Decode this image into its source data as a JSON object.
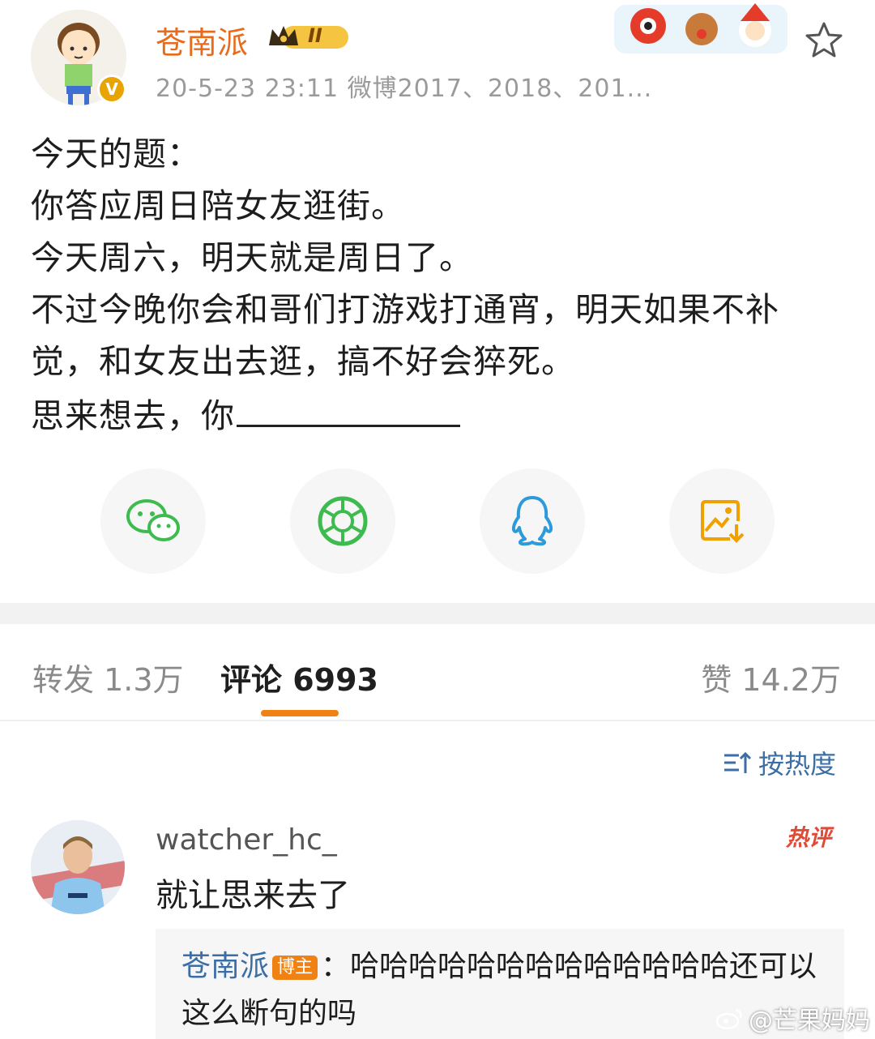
{
  "header": {
    "username": "苍南派",
    "level_badge": "II",
    "meta": "20-5-23 23:11  微博2017、2018、201...",
    "icons": [
      "avatar",
      "verified-badge",
      "crown-badge",
      "festive-banner",
      "star-icon"
    ]
  },
  "post": {
    "lines": [
      "今天的题：",
      "你答应周日陪女友逛街。",
      "今天周六，明天就是周日了。",
      "不过今晚你会和哥们打游戏打通宵，明天如果不补",
      "觉，和女友出去逛，搞不好会猝死。",
      "思来想去，你"
    ]
  },
  "share": {
    "icons": [
      "wechat-icon",
      "moments-icon",
      "qq-icon",
      "save-image-icon"
    ]
  },
  "tabs": {
    "repost": "转发 1.3万",
    "comments": "评论 6993",
    "likes": "赞 14.2万"
  },
  "sort": {
    "label": "按热度"
  },
  "comment": {
    "username": "watcher_hc_",
    "text": "就让思来去了",
    "hot_tag": "热评",
    "reply": {
      "author": "苍南派",
      "tag": "博主",
      "text": "：哈哈哈哈哈哈哈哈哈哈哈哈哈还可以这么断句的吗"
    }
  },
  "watermark": "@芒果妈妈",
  "colors": {
    "accent": "#f08214",
    "username": "#e86b1c",
    "link": "#3a6ea5",
    "wechat": "#3dbb4f",
    "qq": "#2d9ad9",
    "save": "#f0a000"
  }
}
